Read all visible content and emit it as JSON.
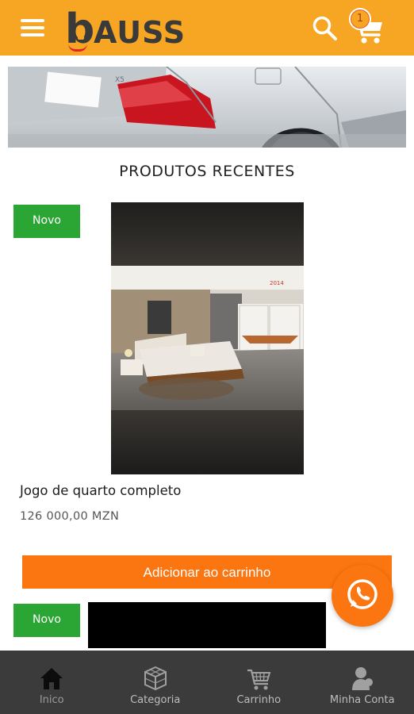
{
  "header": {
    "logo_text": "AUSS",
    "logo_letter": "b",
    "cart_count": "1",
    "accent_color": "#f7a623"
  },
  "icons": {
    "menu": "hamburger-icon",
    "search": "search-icon",
    "cart": "cart-icon",
    "whatsapp": "whatsapp-icon"
  },
  "main": {
    "section_title": "PRODUTOS RECENTES",
    "products": [
      {
        "badge": "Novo",
        "name": "Jogo de quarto completo",
        "price": "126 000,00 MZN",
        "add_to_cart_label": "Adicionar ao carrinho"
      },
      {
        "badge": "Novo"
      }
    ]
  },
  "bottom_nav": {
    "items": [
      {
        "label": "Inico",
        "icon": "home-icon"
      },
      {
        "label": "Categoria",
        "icon": "cube-icon"
      },
      {
        "label": "Carrinho",
        "icon": "cart-icon"
      },
      {
        "label": "Minha Conta",
        "icon": "user-icon"
      }
    ]
  },
  "colors": {
    "primary_orange": "#fb7510",
    "badge_green": "#2ba534",
    "nav_background": "#3b3b3b"
  }
}
